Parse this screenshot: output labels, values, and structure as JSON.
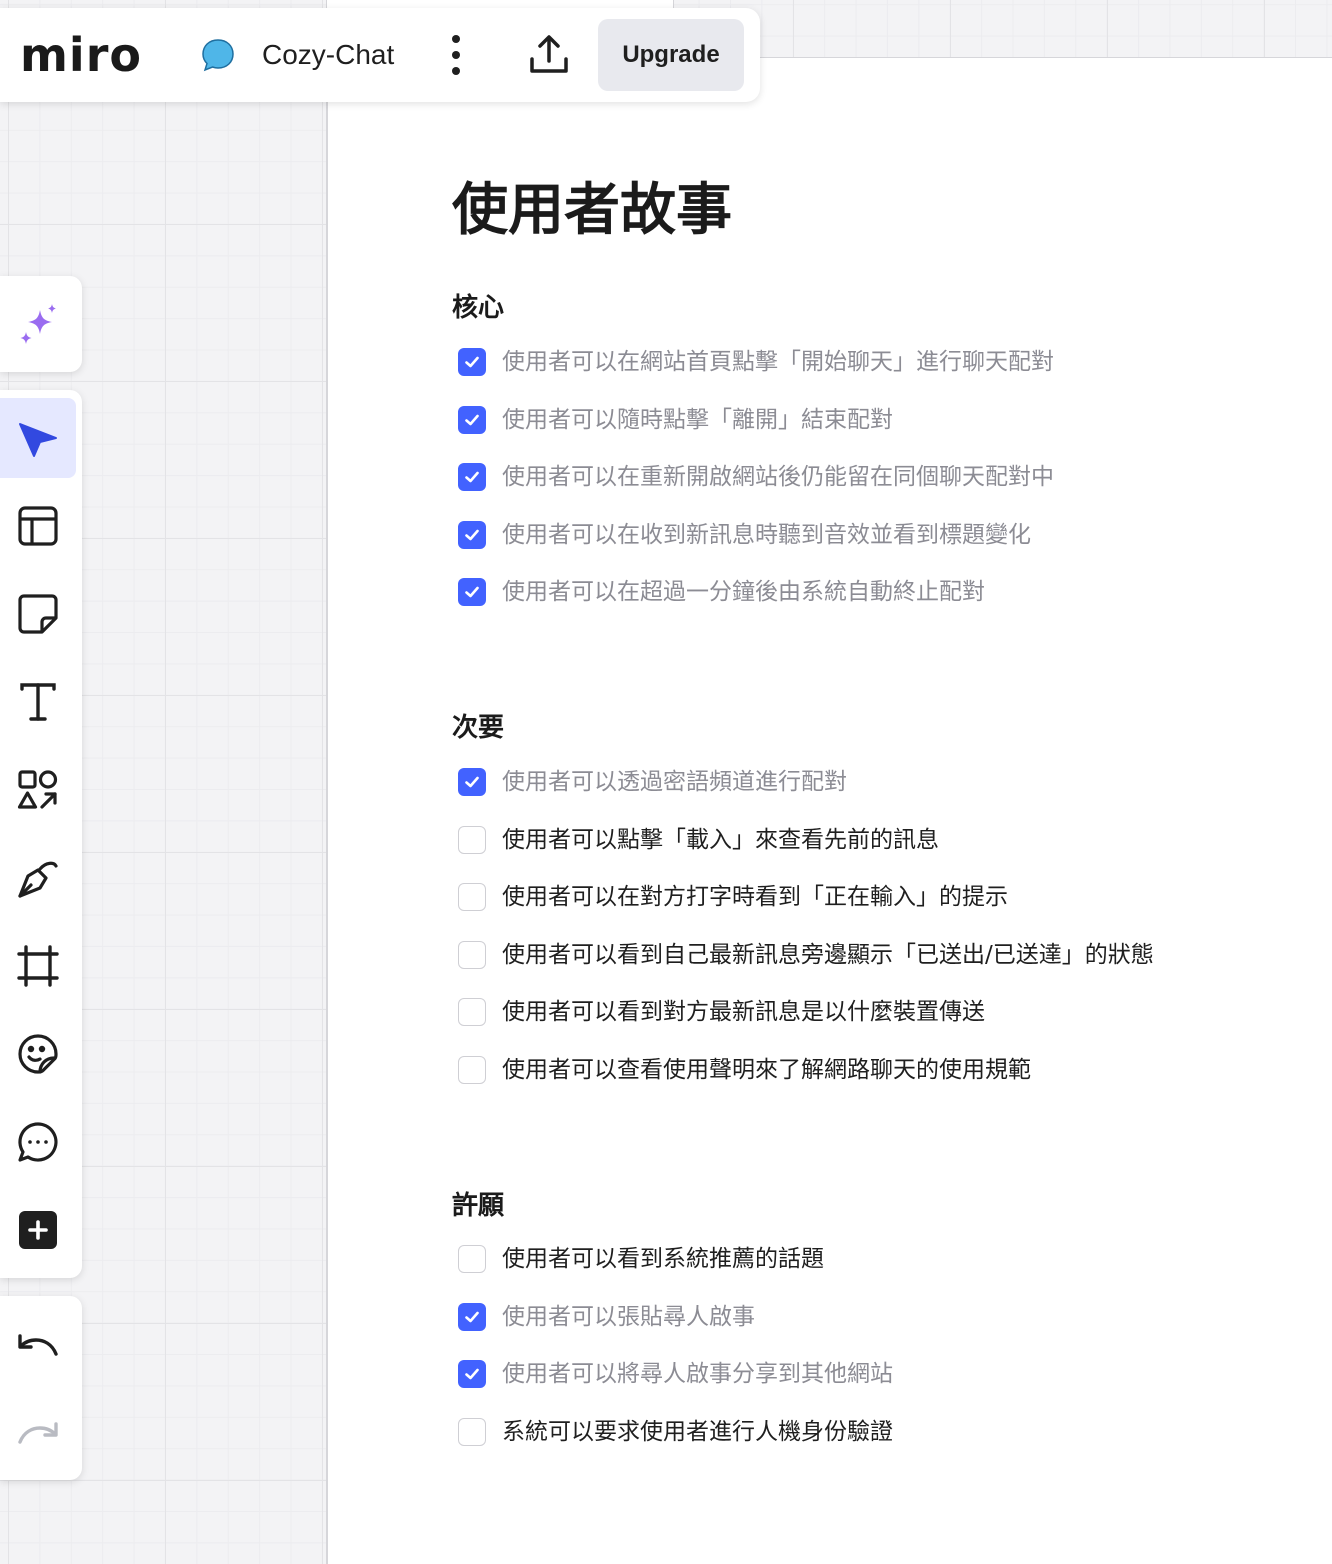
{
  "app": {
    "logo": "miro",
    "board_name": "Cozy-Chat",
    "upgrade_label": "Upgrade"
  },
  "toolbar": {
    "icons": [
      "chat-bubble-icon",
      "more-icon",
      "share-upload-icon"
    ]
  },
  "tools": [
    {
      "name": "ai-sparkle-icon",
      "active": false
    },
    {
      "name": "select-cursor-icon",
      "active": true
    },
    {
      "name": "templates-icon",
      "active": false
    },
    {
      "name": "sticky-note-icon",
      "active": false
    },
    {
      "name": "text-icon",
      "active": false
    },
    {
      "name": "shapes-icon",
      "active": false
    },
    {
      "name": "pen-icon",
      "active": false
    },
    {
      "name": "frame-icon",
      "active": false
    },
    {
      "name": "sticker-icon",
      "active": false
    },
    {
      "name": "comment-icon",
      "active": false
    },
    {
      "name": "more-apps-plus-icon",
      "active": false
    },
    {
      "name": "undo-icon",
      "active": false
    },
    {
      "name": "redo-icon",
      "active": false
    }
  ],
  "doc": {
    "title": "使用者故事",
    "sections": [
      {
        "heading": "核心",
        "tasks": [
          {
            "text": "使用者可以在網站首頁點擊「開始聊天」進行聊天配對",
            "checked": true
          },
          {
            "text": "使用者可以隨時點擊「離開」結束配對",
            "checked": true
          },
          {
            "text": "使用者可以在重新開啟網站後仍能留在同個聊天配對中",
            "checked": true
          },
          {
            "text": "使用者可以在收到新訊息時聽到音效並看到標題變化",
            "checked": true
          },
          {
            "text": "使用者可以在超過一分鐘後由系統自動終止配對",
            "checked": true
          }
        ]
      },
      {
        "heading": "次要",
        "tasks": [
          {
            "text": "使用者可以透過密語頻道進行配對",
            "checked": true
          },
          {
            "text": "使用者可以點擊「載入」來查看先前的訊息",
            "checked": false
          },
          {
            "text": "使用者可以在對方打字時看到「正在輸入」的提示",
            "checked": false
          },
          {
            "text": "使用者可以看到自己最新訊息旁邊顯示「已送出/已送達」的狀態",
            "checked": false
          },
          {
            "text": "使用者可以看到對方最新訊息是以什麼裝置傳送",
            "checked": false
          },
          {
            "text": "使用者可以查看使用聲明來了解網路聊天的使用規範",
            "checked": false
          }
        ]
      },
      {
        "heading": "許願",
        "tasks": [
          {
            "text": "使用者可以看到系統推薦的話題",
            "checked": false
          },
          {
            "text": "使用者可以張貼尋人啟事",
            "checked": true
          },
          {
            "text": "使用者可以將尋人啟事分享到其他網站",
            "checked": true
          },
          {
            "text": "系統可以要求使用者進行人機身份驗證",
            "checked": false
          }
        ]
      }
    ]
  },
  "colors": {
    "accent": "#4262ff",
    "checked_text": "#8c8c94",
    "text": "#1f1f1f",
    "sparkle": "#8b5cf6",
    "chat_bubble": "#4fb6e8"
  }
}
